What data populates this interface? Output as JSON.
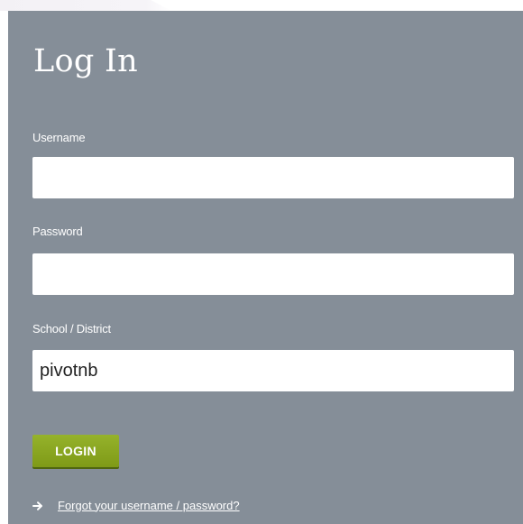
{
  "login": {
    "title": "Log In",
    "username": {
      "label": "Username",
      "value": ""
    },
    "password": {
      "label": "Password",
      "value": ""
    },
    "school": {
      "label": "School / District",
      "value": "pivotnb"
    },
    "login_button_label": "LOGIN",
    "forgot_link_text": "Forgot your username / password?",
    "forgot_icon": "arrow-right-icon"
  },
  "colors": {
    "panel_background": "#858e98",
    "login_button": "#8aa521",
    "text": "#ffffff",
    "input_background": "#ffffff"
  }
}
